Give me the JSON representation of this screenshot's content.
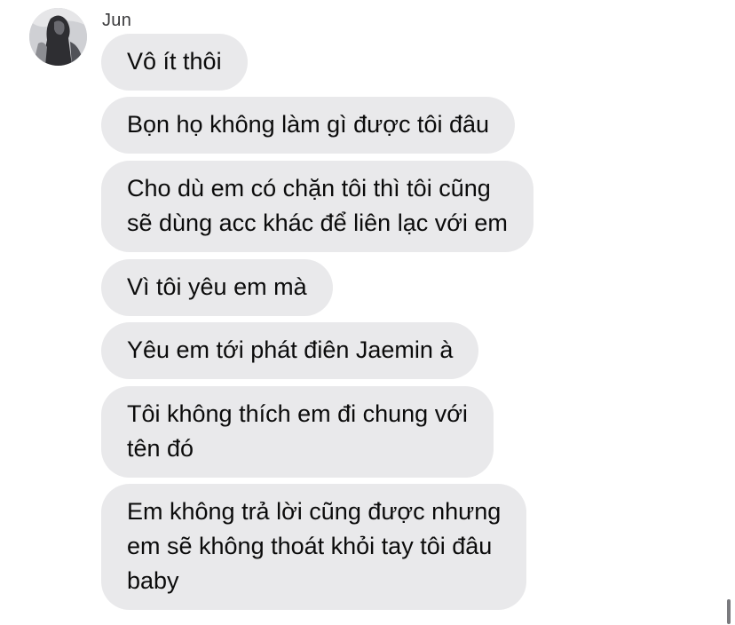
{
  "conversation": {
    "sender_name": "Jun",
    "bubble_color": "#e9e9eb",
    "text_color": "#0b0b0b",
    "messages": [
      {
        "lines": [
          "Vô ít thôi"
        ]
      },
      {
        "lines": [
          "Bọn họ không làm gì được tôi đâu"
        ]
      },
      {
        "lines": [
          "Cho dù em có chặn tôi thì tôi cũng",
          "sẽ dùng acc khác để liên lạc với em"
        ]
      },
      {
        "lines": [
          "Vì tôi yêu em mà"
        ]
      },
      {
        "lines": [
          "Yêu em tới phát điên Jaemin à"
        ]
      },
      {
        "lines": [
          "Tôi không thích em đi chung với",
          "tên đó"
        ]
      },
      {
        "lines": [
          "Em không trả lời cũng được nhưng",
          "em sẽ không thoát khỏi tay tôi đâu",
          "baby"
        ]
      }
    ]
  }
}
